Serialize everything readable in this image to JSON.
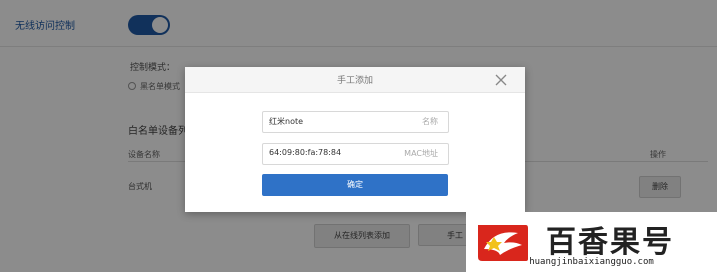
{
  "background": {
    "section_title": "无线访问控制",
    "control_mode_label": "控制模式：",
    "radio_label": "黑名单模式（",
    "whitelist_title": "白名单设备列",
    "table": {
      "col_device_name": "设备名称",
      "col_operation": "操作",
      "rows": [
        {
          "name": "台式机",
          "action": "删除"
        }
      ]
    },
    "add_from_online_button": "从在线列表添加",
    "manual_add_button": "手工"
  },
  "modal": {
    "title": "手工添加",
    "name_field": {
      "value": "红米note",
      "hint": "名称"
    },
    "mac_field": {
      "value": "64:09:80:fa:78:84",
      "hint": "MAC地址"
    },
    "confirm_button": "确定"
  },
  "watermark": {
    "brand_name": "百香果号",
    "url": "huangjinbaixiangguo.com"
  },
  "colors": {
    "accent": "#1f5aa6",
    "confirm": "#2f72c7",
    "logo_red": "#d9261c",
    "logo_gold": "#f2c21b"
  },
  "icons": {
    "close": "close-icon",
    "toggle": "toggle-switch",
    "logo": "dragon-logo-icon"
  }
}
